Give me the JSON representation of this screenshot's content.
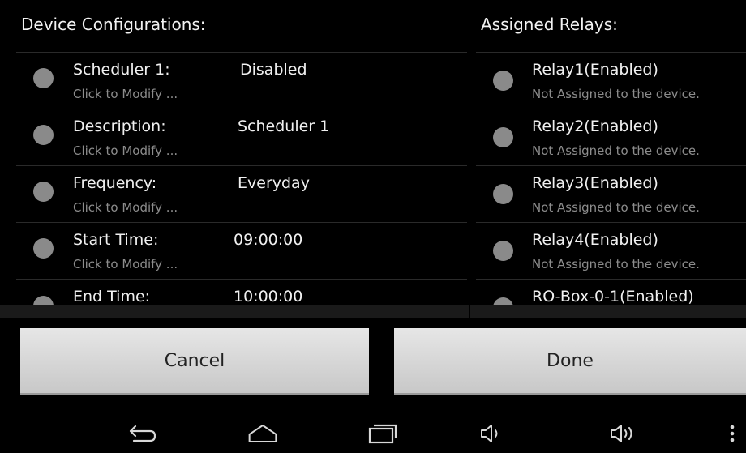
{
  "left_panel": {
    "title": "Device Configurations:",
    "rows": [
      {
        "label": "Scheduler 1:",
        "value": "Disabled",
        "sub": "Click to Modify ..."
      },
      {
        "label": "Description:",
        "value": "Scheduler 1",
        "sub": "Click to Modify ..."
      },
      {
        "label": "Frequency:",
        "value": "Everyday",
        "sub": "Click to Modify ..."
      },
      {
        "label": "Start Time:",
        "value": "09:00:00",
        "sub": "Click to Modify ..."
      },
      {
        "label": "End Time:",
        "value": "10:00:00",
        "sub": ""
      }
    ]
  },
  "right_panel": {
    "title": "Assigned Relays:",
    "rows": [
      {
        "label": "Relay1(Enabled)",
        "sub": "Not Assigned to the device."
      },
      {
        "label": "Relay2(Enabled)",
        "sub": "Not Assigned to the device."
      },
      {
        "label": "Relay3(Enabled)",
        "sub": "Not Assigned to the device."
      },
      {
        "label": "Relay4(Enabled)",
        "sub": "Not Assigned to the device."
      },
      {
        "label": "RO-Box-0-1(Enabled)",
        "sub": ""
      }
    ]
  },
  "buttons": {
    "cancel": "Cancel",
    "done": "Done"
  },
  "navbar": {
    "icons": [
      "back-icon",
      "home-icon",
      "recents-icon",
      "volume-down-icon",
      "volume-up-icon",
      "overflow-menu-icon"
    ]
  },
  "colors": {
    "background": "#000000",
    "radio": "#8a8a8a",
    "subtext": "#8c8c8c",
    "button": "#d6d6d6"
  }
}
